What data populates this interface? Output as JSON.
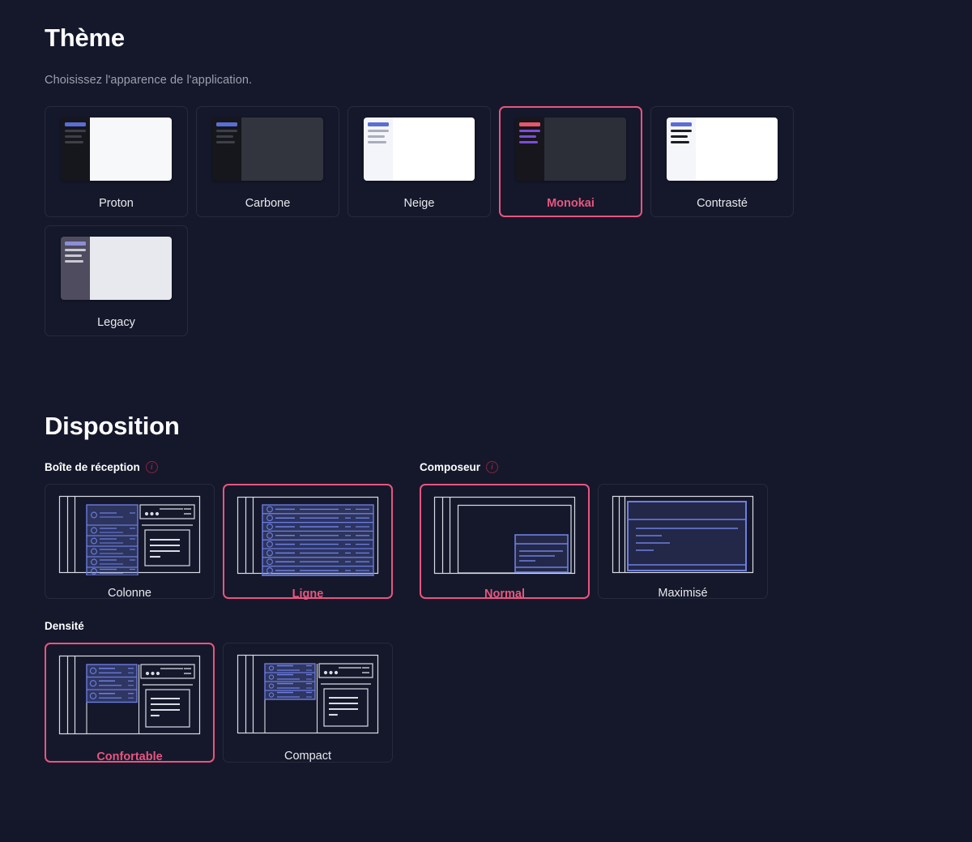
{
  "theme": {
    "title": "Thème",
    "subtitle": "Choisissez l'apparence de l'application.",
    "options": [
      {
        "label": "Proton",
        "selected": false,
        "side_bg": "#15171d",
        "main_bg": "#f7f8fa",
        "accent": "#5a6ed6",
        "line": "#3d4048",
        "side_border": ""
      },
      {
        "label": "Carbone",
        "selected": false,
        "side_bg": "#15171d",
        "main_bg": "#32353d",
        "accent": "#5a6ed6",
        "line": "#3d4048",
        "side_border": ""
      },
      {
        "label": "Neige",
        "selected": false,
        "side_bg": "#f3f5fa",
        "main_bg": "#ffffff",
        "accent": "#5a6ed6",
        "line": "#a9aebb",
        "side_border": ""
      },
      {
        "label": "Monokai",
        "selected": true,
        "side_bg": "#16161c",
        "main_bg": "#2c2f38",
        "accent": "#e8556b",
        "line": "#7c4ddb",
        "side_border": ""
      },
      {
        "label": "Contrasté",
        "selected": false,
        "side_bg": "#f5f6fa",
        "main_bg": "#ffffff",
        "accent": "#5a6ed6",
        "line": "#1c1e26",
        "side_border": ""
      },
      {
        "label": "Legacy",
        "selected": false,
        "side_bg": "#4e4c5e",
        "main_bg": "#e8e9ee",
        "accent": "#8d8ed6",
        "line": "#c8c9d2",
        "side_border": ""
      }
    ]
  },
  "disposition": {
    "title": "Disposition",
    "inbox": {
      "label": "Boîte de réception",
      "info_icon": "info-icon",
      "options": [
        {
          "label": "Colonne",
          "selected": false,
          "variant": "column"
        },
        {
          "label": "Ligne",
          "selected": true,
          "variant": "row"
        }
      ]
    },
    "composer": {
      "label": "Composeur",
      "info_icon": "info-icon",
      "options": [
        {
          "label": "Normal",
          "selected": true,
          "variant": "normal"
        },
        {
          "label": "Maximisé",
          "selected": false,
          "variant": "maximized"
        }
      ]
    },
    "density": {
      "label": "Densité",
      "options": [
        {
          "label": "Confortable",
          "selected": true,
          "variant": "comfortable"
        },
        {
          "label": "Compact",
          "selected": false,
          "variant": "compact"
        }
      ]
    }
  },
  "colors": {
    "background": "#15182b",
    "accent_selected": "#e8557f",
    "card_border": "#262a3d",
    "wire_blue": "#6d7fe0",
    "wire_white": "#d9dbe4",
    "text_primary": "#ffffff",
    "text_muted": "#9aa0ad"
  }
}
